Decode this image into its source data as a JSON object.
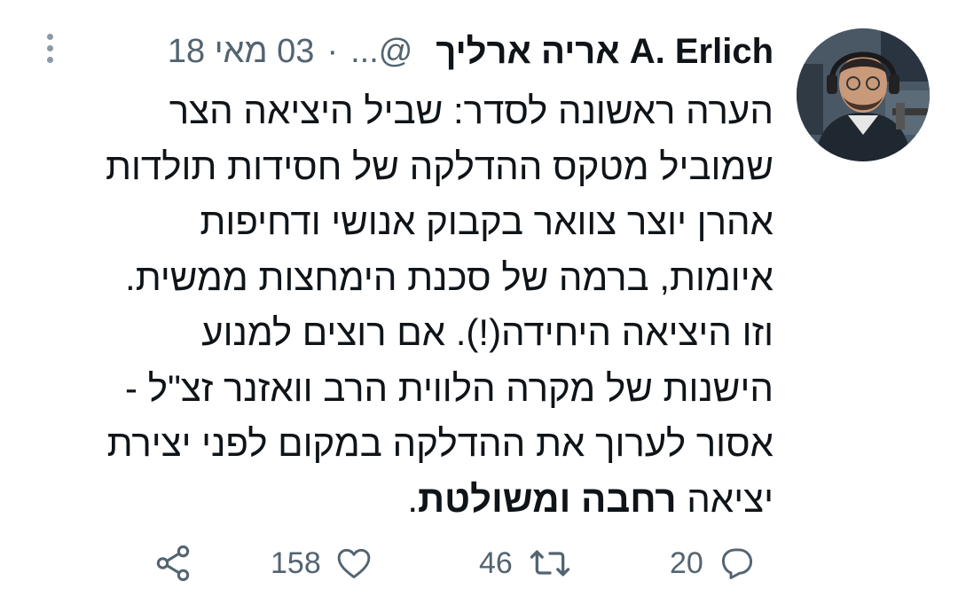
{
  "tweet": {
    "author_name": "A. Erlich אריה ארליך",
    "handle": "@...",
    "separator": "·",
    "date": "03 מאי 18",
    "body_lines": [
      "הערה ראשונה לסדר: שביל היציאה הצר",
      "שמוביל מטקס ההדלקה של חסידות תולדות",
      "אהרן יוצר צוואר בקבוק אנושי ודחיפות",
      "איומות, ברמה של סכנת הימחצות ממשית.",
      "וזו היציאה היחידה(!). אם רוצים למנוע",
      "הישנות של מקרה הלווית הרב וואזנר זצ\"ל -",
      "אסור לערוך את ההדלקה במקום לפני יצירת"
    ],
    "last_line_prefix": "יציאה",
    "last_line_bold_1": "רחבה",
    "last_line_bold_2": "ומשולטת",
    "last_line_suffix": "."
  },
  "actions": {
    "reply_count": "20",
    "retweet_count": "46",
    "like_count": "158"
  },
  "icons": {
    "menu": "more-vertical-icon",
    "reply": "reply-icon",
    "retweet": "retweet-icon",
    "like": "heart-icon",
    "share": "share-icon"
  },
  "colors": {
    "text": "#0f1419",
    "muted": "#536471"
  }
}
